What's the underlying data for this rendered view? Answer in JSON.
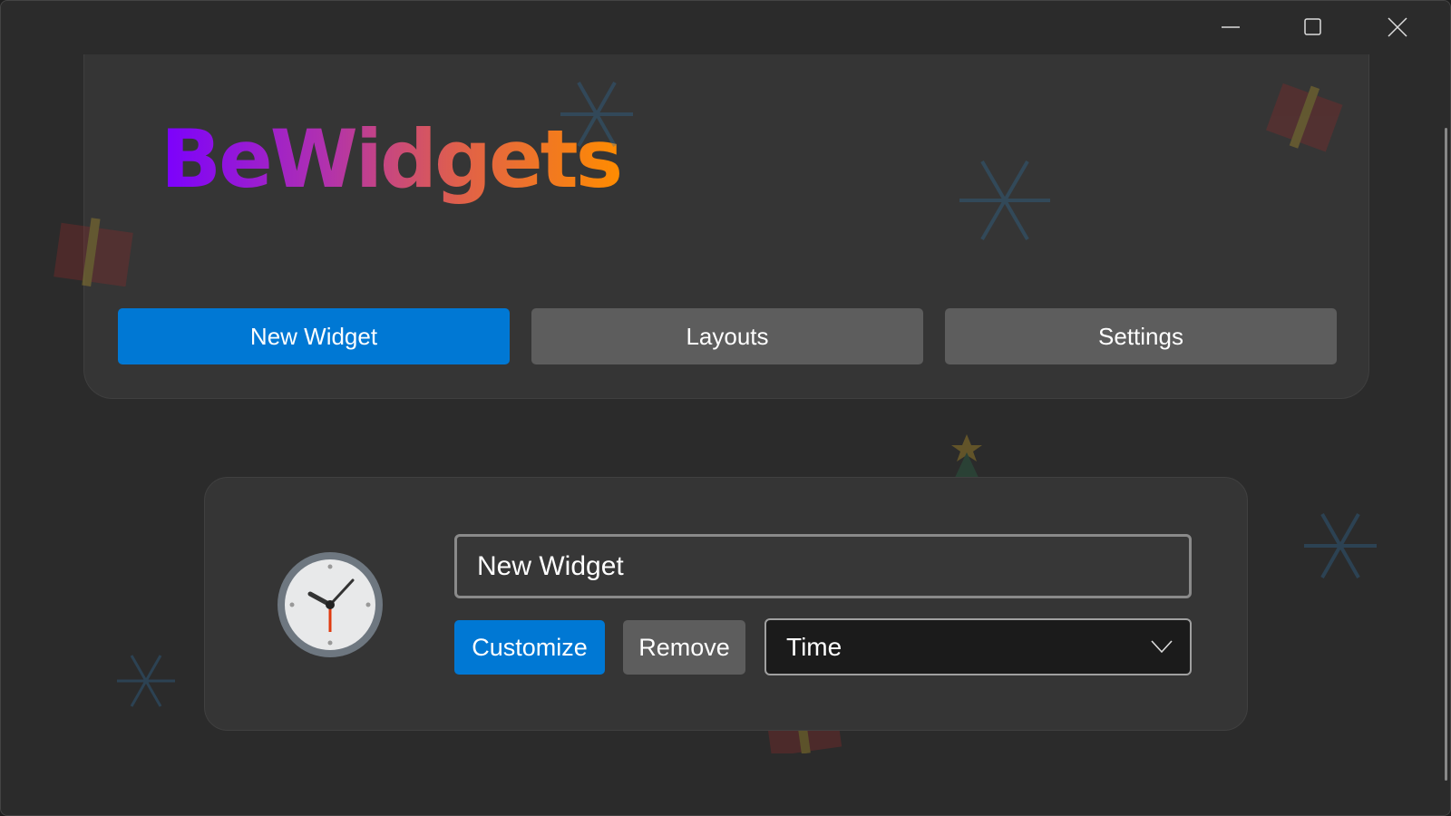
{
  "window": {
    "controls": {
      "minimize": "minimize-icon",
      "maximize": "maximize-icon",
      "close": "close-icon"
    }
  },
  "header": {
    "title": "BeWidgets",
    "title_gradient": [
      "#7a00ff",
      "#ff8c00"
    ]
  },
  "nav": {
    "new_widget": "New Widget",
    "layouts": "Layouts",
    "settings": "Settings"
  },
  "widget_card": {
    "icon": "clock-icon",
    "name_value": "New Widget",
    "customize_label": "Customize",
    "remove_label": "Remove",
    "type_selected": "Time"
  },
  "colors": {
    "accent": "#0078d4",
    "secondary_button": "#5d5d5d",
    "background": "#2b2b2b",
    "panel": "#353535"
  }
}
